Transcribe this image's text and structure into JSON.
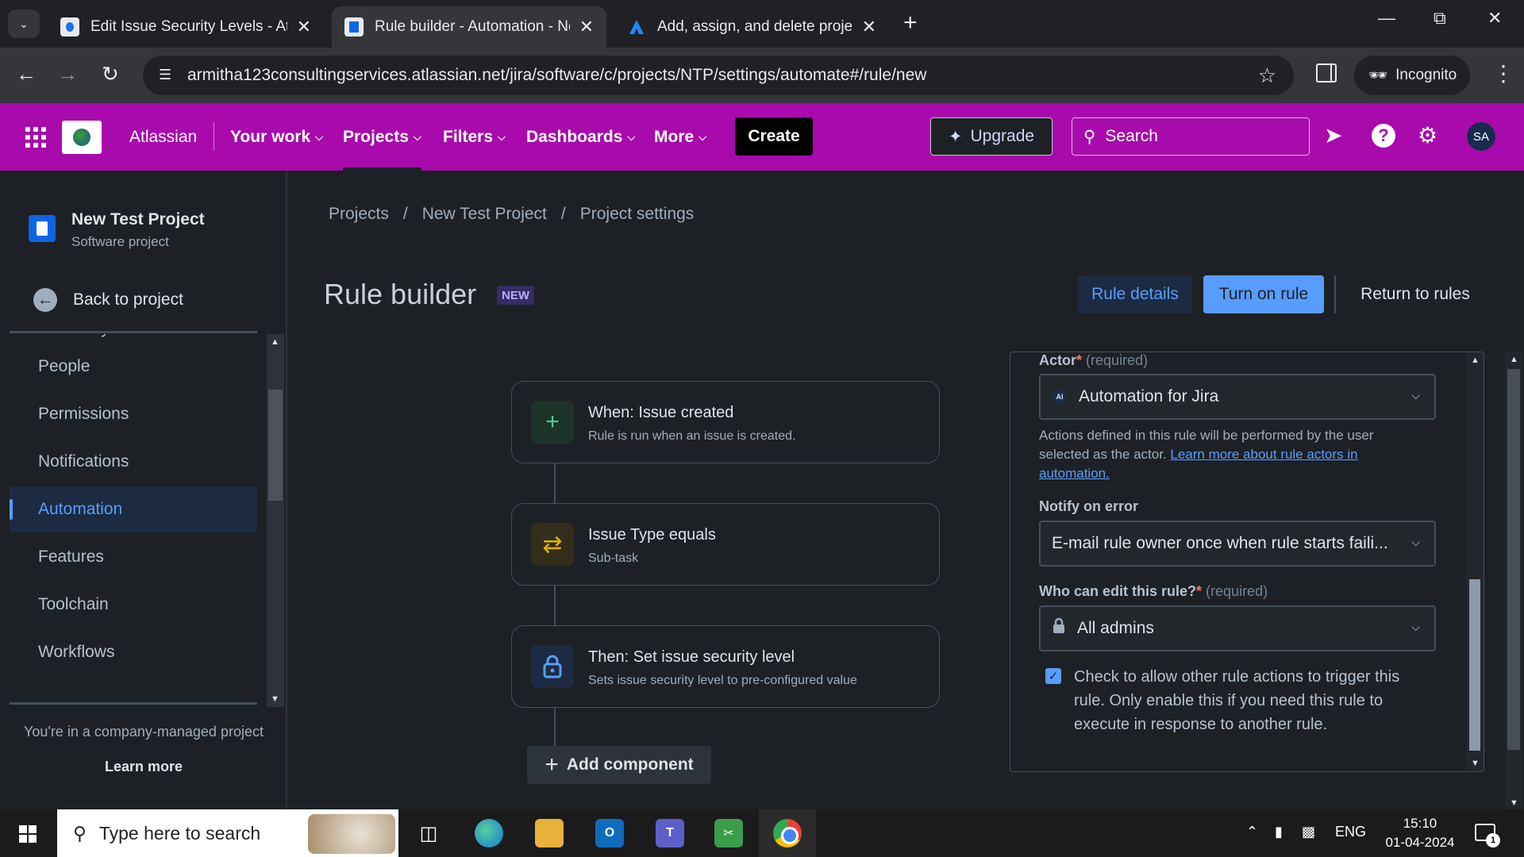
{
  "browser": {
    "tabs": [
      {
        "title": "Edit Issue Security Levels - Atlassian",
        "active": false
      },
      {
        "title": "Rule builder - Automation - New Test Project",
        "active": true
      },
      {
        "title": "Add, assign, and delete project",
        "active": false
      }
    ],
    "url": "armitha123consultingservices.atlassian.net/jira/software/c/projects/NTP/settings/automate#/rule/new",
    "profile_label": "Incognito"
  },
  "header": {
    "brand": "Atlassian",
    "nav": [
      {
        "label": "Your work"
      },
      {
        "label": "Projects",
        "selected": true
      },
      {
        "label": "Filters"
      },
      {
        "label": "Dashboards"
      },
      {
        "label": "More"
      }
    ],
    "create_label": "Create",
    "upgrade_label": "Upgrade",
    "search_placeholder": "Search",
    "avatar_initials": "SA",
    "accent_color": "#a80aac"
  },
  "sidebar": {
    "project_name": "New Test Project",
    "project_type": "Software project",
    "back_label": "Back to project",
    "partial_top": "Summary",
    "items": [
      {
        "label": "People"
      },
      {
        "label": "Permissions"
      },
      {
        "label": "Notifications"
      },
      {
        "label": "Automation",
        "active": true
      },
      {
        "label": "Features"
      },
      {
        "label": "Toolchain"
      },
      {
        "label": "Workflows"
      }
    ],
    "company_text": "You're in a company-managed project",
    "learn_more": "Learn more"
  },
  "main": {
    "breadcrumb": [
      "Projects",
      "New Test Project",
      "Project settings"
    ],
    "title": "Rule builder",
    "badge": "NEW",
    "buttons": {
      "rule_details": "Rule details",
      "turn_on": "Turn on rule",
      "return": "Return to rules"
    },
    "flow": [
      {
        "title": "When: Issue created",
        "subtitle": "Rule is run when an issue is created.",
        "icon": "plus-icon"
      },
      {
        "title": "Issue Type equals",
        "subtitle": "Sub-task",
        "icon": "shuffle-icon"
      },
      {
        "title": "Then: Set issue security level",
        "subtitle": "Sets issue security level to pre-configured value",
        "icon": "lock-icon"
      }
    ],
    "add_component": "Add component"
  },
  "panel": {
    "actor_label": "Actor",
    "actor_required": "(required)",
    "actor_value": "Automation for Jira",
    "actor_badge": "AI",
    "actor_help": "Actions defined in this rule will be performed by the user selected as the actor. ",
    "actor_help_link": "Learn more about rule actors in automation.",
    "notify_label": "Notify on error",
    "notify_value": "E-mail rule owner once when rule starts faili...",
    "edit_label": "Who can edit this rule?",
    "edit_required": "(required)",
    "edit_value": "All admins",
    "checkbox_label": "Check to allow other rule actions to trigger this rule. Only enable this if you need this rule to execute in response to another rule.",
    "checkbox_checked": true
  },
  "taskbar": {
    "search_placeholder": "Type here to search",
    "lang": "ENG",
    "time": "15:10",
    "date": "01-04-2024",
    "notifications": "1"
  }
}
